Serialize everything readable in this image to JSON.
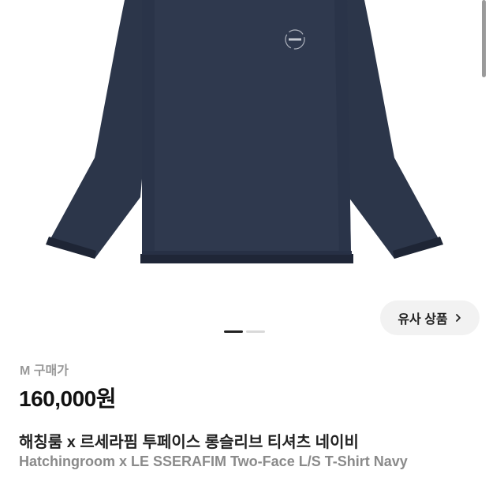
{
  "product": {
    "similar_label": "유사 상품",
    "size_label": "M 구매가",
    "price": "160,000원",
    "title_ko": "해칭룸 x 르세라핌 투페이스 롱슬리브 티셔츠 네이비",
    "title_en": "Hatchingroom x LE SSERAFIM Two-Face L/S T-Shirt Navy"
  },
  "carousel": {
    "total": 2,
    "current": 1
  },
  "colors": {
    "shirt_navy": "#2c364a",
    "shirt_shadow": "#222a3b",
    "dot_active": "#222222",
    "dot_inactive": "#d9d9d9",
    "button_bg": "#f2f2f2",
    "muted_text": "#8a8a8a"
  },
  "icons": {
    "similar_chevron": "chevron-right-icon",
    "logo": "circle-logo-icon"
  }
}
